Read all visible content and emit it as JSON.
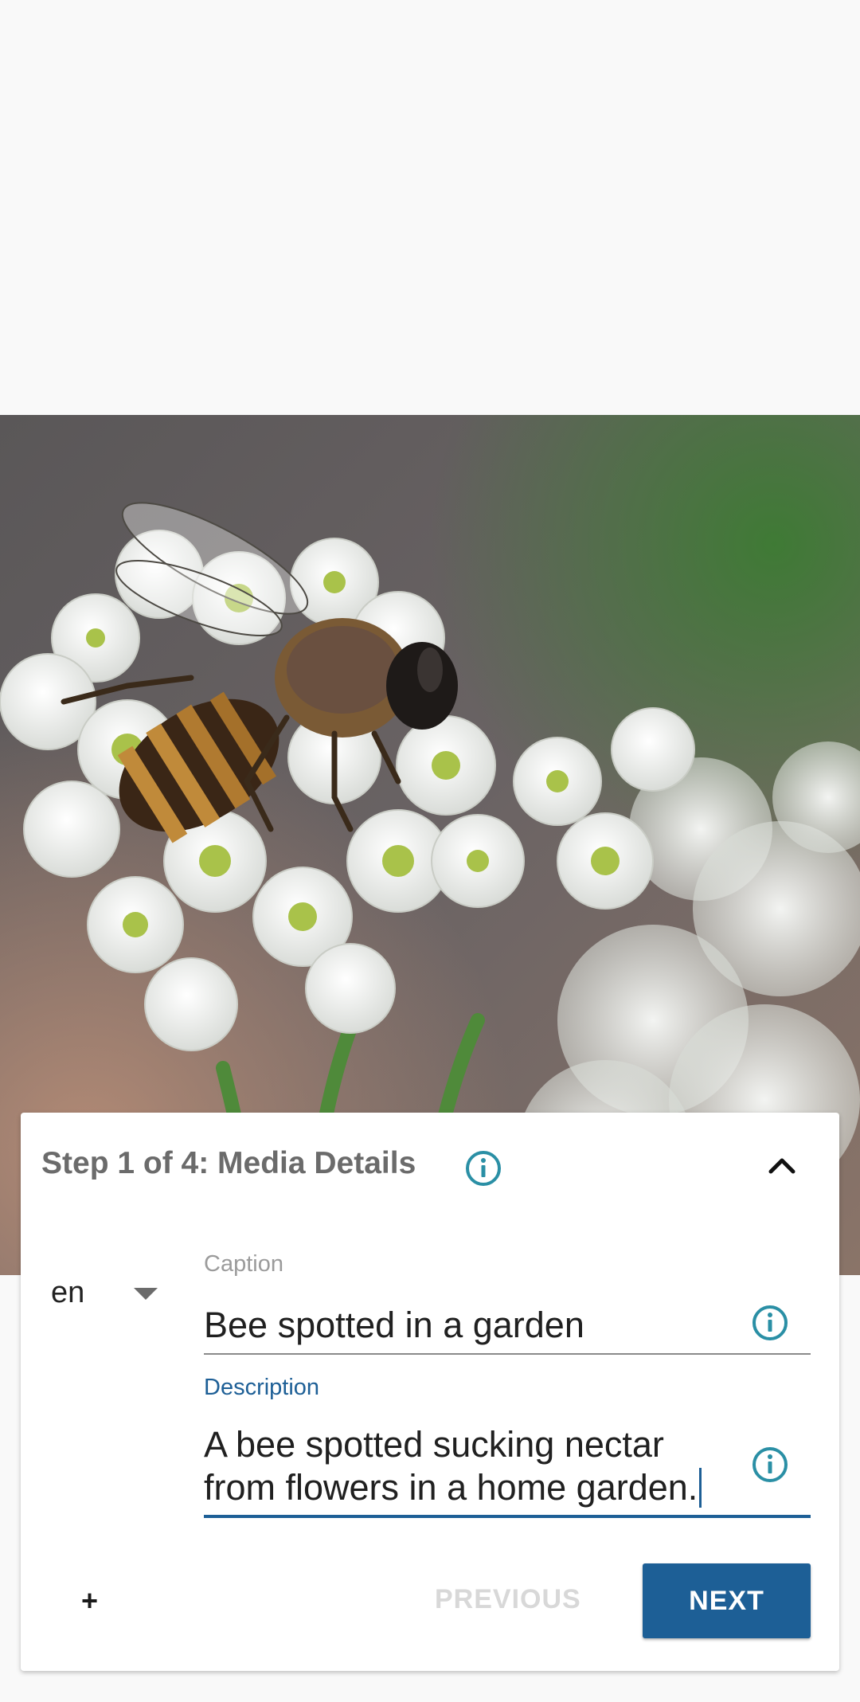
{
  "photo": {
    "subject": "bee-on-white-flowers"
  },
  "step_card": {
    "title": "Step 1 of 4: Media Details"
  },
  "language": {
    "selected": "en"
  },
  "caption": {
    "label": "Caption",
    "value": "Bee spotted in a garden"
  },
  "description": {
    "label": "Description",
    "value": "A bee spotted sucking nectar from flowers in a home garden."
  },
  "actions": {
    "add_label": "+",
    "previous_label": "PREVIOUS",
    "next_label": "NEXT"
  },
  "colors": {
    "accent": "#1d5f96",
    "info_icon": "#2a8fa5",
    "title_text": "#6b6b6b",
    "disabled_text": "#d8d8d8",
    "background": "#f9f9f9"
  }
}
